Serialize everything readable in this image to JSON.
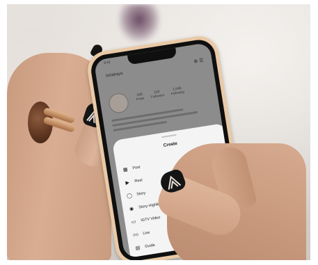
{
  "phone": {
    "status_time": "9:41",
    "profile_name": "betakaya",
    "stats": [
      {
        "num": "245",
        "label": "Posts"
      },
      {
        "num": "11K",
        "label": "Followers"
      },
      {
        "num": "1,045",
        "label": "Following"
      }
    ]
  },
  "sheet": {
    "title": "Create",
    "items": [
      {
        "icon": "post-grid-icon",
        "glyph": "▦",
        "label": "Post"
      },
      {
        "icon": "reel-icon",
        "glyph": "▶",
        "label": "Reel"
      },
      {
        "icon": "story-icon",
        "glyph": "◯",
        "label": "Story"
      },
      {
        "icon": "story-highlight-icon",
        "glyph": "◉",
        "label": "Story Highlight"
      },
      {
        "icon": "igtv-icon",
        "glyph": "▭",
        "label": "IGTV Video"
      },
      {
        "icon": "live-icon",
        "glyph": "((•))",
        "label": "Live"
      },
      {
        "icon": "guide-icon",
        "glyph": "▤",
        "label": "Guide"
      }
    ]
  },
  "colors": {
    "nail": "#151515",
    "sheet_bg": "#f4f4f4",
    "phone_case": "#e9c9a6"
  }
}
